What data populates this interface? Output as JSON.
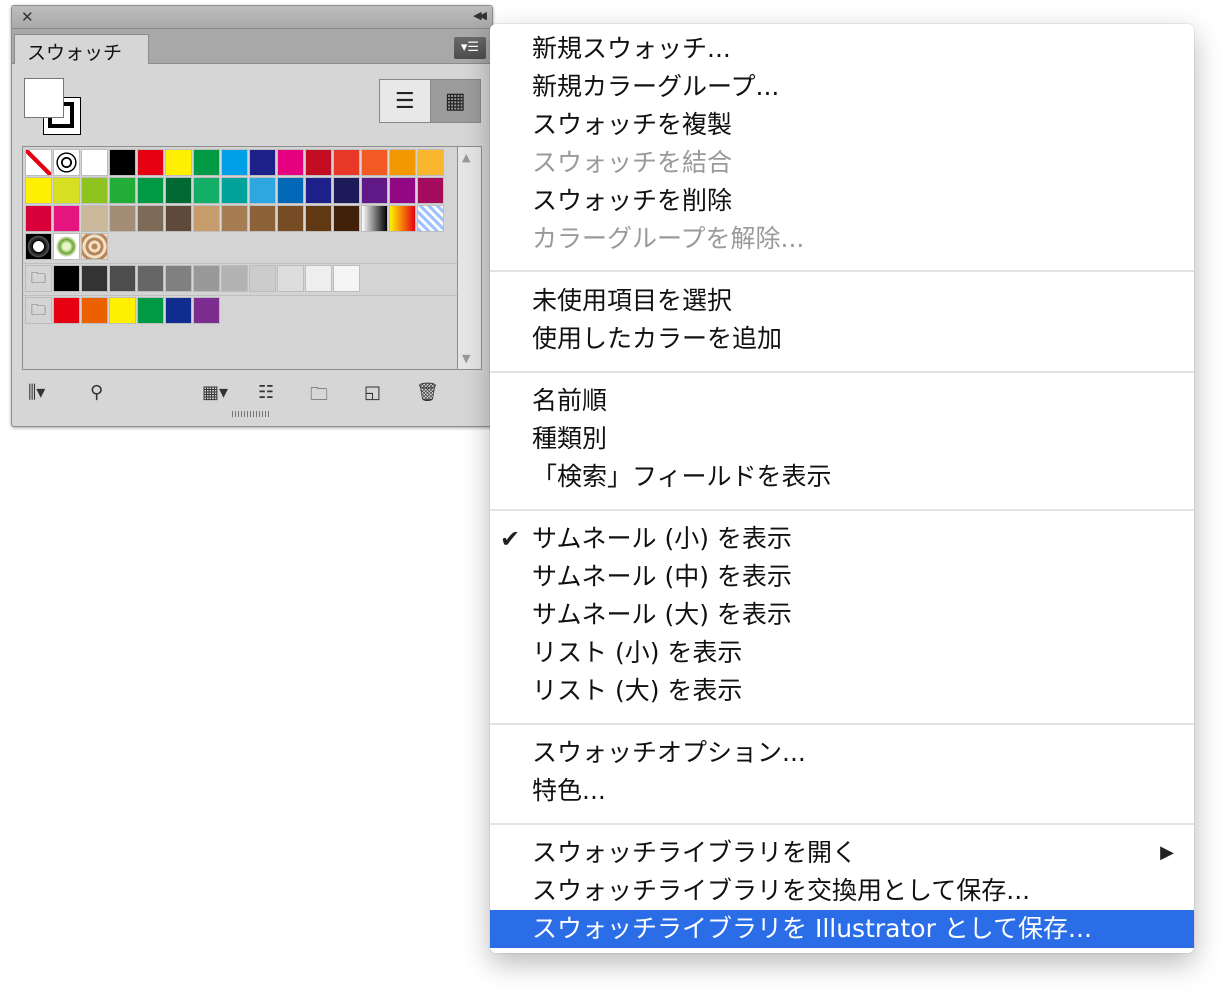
{
  "panel": {
    "close_glyph": "✕",
    "collapse_glyph": "◀◀",
    "tab_label": "スウォッチ",
    "menu_button_icon": "panel-menu-icon",
    "swatch_rows": [
      [
        "#none",
        "#registration",
        "#ffffff",
        "#000000",
        "#e60012",
        "#fff100",
        "#009944",
        "#00a0e9",
        "#1d2088",
        "#e4007f",
        "#c30d23",
        "#e83828",
        "#f15a22",
        "#f39800",
        "#f8b62d"
      ],
      [
        "#fff100",
        "#d7df23",
        "#8fc31f",
        "#22ac38",
        "#009944",
        "#006934",
        "#13ae67",
        "#00a29a",
        "#2ea7e0",
        "#0068b7",
        "#1d2088",
        "#1d1a5a",
        "#601986",
        "#920783",
        "#a40b5d"
      ],
      [
        "#d7003a",
        "#e4157f",
        "#c9b89a",
        "#a38d77",
        "#7d6b57",
        "#5d4a3a",
        "#c69c6d",
        "#a67c52",
        "#8c6239",
        "#754c24",
        "#603913",
        "#42210b",
        "#grad-gray",
        "#grad-orange",
        "#pattern-check"
      ],
      [
        "#pattern-a",
        "#pattern-b",
        "#pattern-c"
      ]
    ],
    "group_rows": [
      [
        "#000000",
        "#333333",
        "#4d4d4d",
        "#666666",
        "#808080",
        "#999999",
        "#b3b3b3",
        "#cccccc",
        "#dddddd",
        "#eeeeee",
        "#f5f5f5"
      ],
      [
        "#e60012",
        "#eb6100",
        "#fff100",
        "#009944",
        "#0f2c8e",
        "#7d2c8f"
      ]
    ]
  },
  "menu": {
    "items": [
      {
        "label": "新規スウォッチ..."
      },
      {
        "label": "新規カラーグループ..."
      },
      {
        "label": "スウォッチを複製"
      },
      {
        "label": "スウォッチを結合"
      },
      {
        "label": "スウォッチを削除"
      },
      {
        "label": "カラーグループを解除..."
      },
      {
        "label": "未使用項目を選択"
      },
      {
        "label": "使用したカラーを追加"
      },
      {
        "label": "名前順"
      },
      {
        "label": "種類別"
      },
      {
        "label": "「検索」フィールドを表示"
      },
      {
        "label": "サムネール (小) を表示"
      },
      {
        "label": "サムネール (中) を表示"
      },
      {
        "label": "サムネール (大) を表示"
      },
      {
        "label": "リスト (小) を表示"
      },
      {
        "label": "リスト (大) を表示"
      },
      {
        "label": "スウォッチオプション..."
      },
      {
        "label": "特色..."
      },
      {
        "label": "スウォッチライブラリを開く"
      },
      {
        "label": "スウォッチライブラリを交換用として保存..."
      },
      {
        "label": "スウォッチライブラリを Illustrator として保存..."
      }
    ],
    "check_glyph": "✔",
    "submenu_glyph": "▶",
    "highlight_color": "#2a6de7"
  }
}
